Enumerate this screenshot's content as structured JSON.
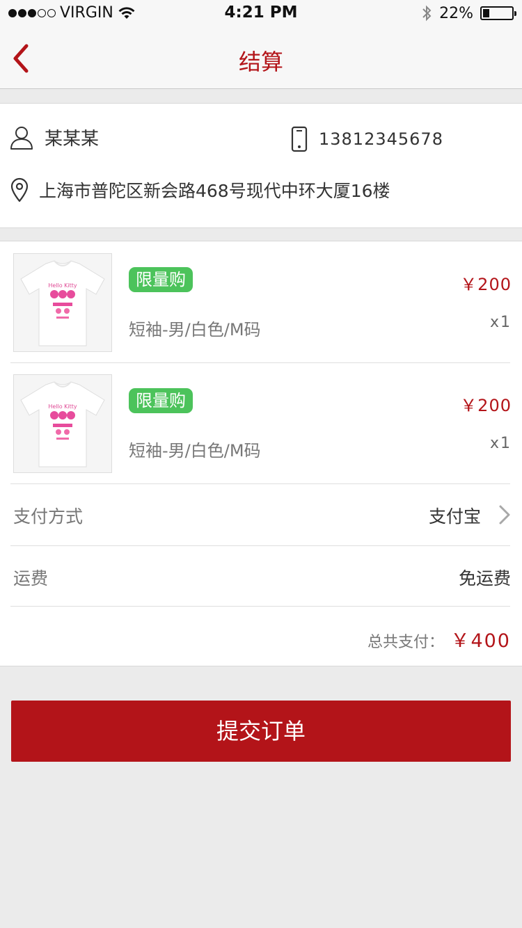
{
  "status_bar": {
    "carrier": "VIRGIN",
    "signal_strength": 3,
    "signal_max": 5,
    "time": "4:21 PM",
    "battery_text": "22%",
    "battery_level": 0.22
  },
  "nav": {
    "back_icon": "chevron-left-icon",
    "title": "结算"
  },
  "address": {
    "name": "某某某",
    "phone": "13812345678",
    "address": "上海市普陀区新会路468号现代中环大厦16楼"
  },
  "products": [
    {
      "badge": "限量购",
      "spec": "短袖-男/白色/M码",
      "price": "￥200",
      "quantity": "x1"
    },
    {
      "badge": "限量购",
      "spec": "短袖-男/白色/M码",
      "price": "￥200",
      "quantity": "x1"
    }
  ],
  "payment": {
    "label": "支付方式",
    "value": "支付宝"
  },
  "shipping": {
    "label": "运费",
    "value": "免运费"
  },
  "total": {
    "label": "总共支付：",
    "amount": "￥400"
  },
  "submit_label": "提交订单",
  "colors": {
    "brand_red": "#b31419",
    "badge_green": "#4cc35b",
    "background": "#ebebeb"
  }
}
